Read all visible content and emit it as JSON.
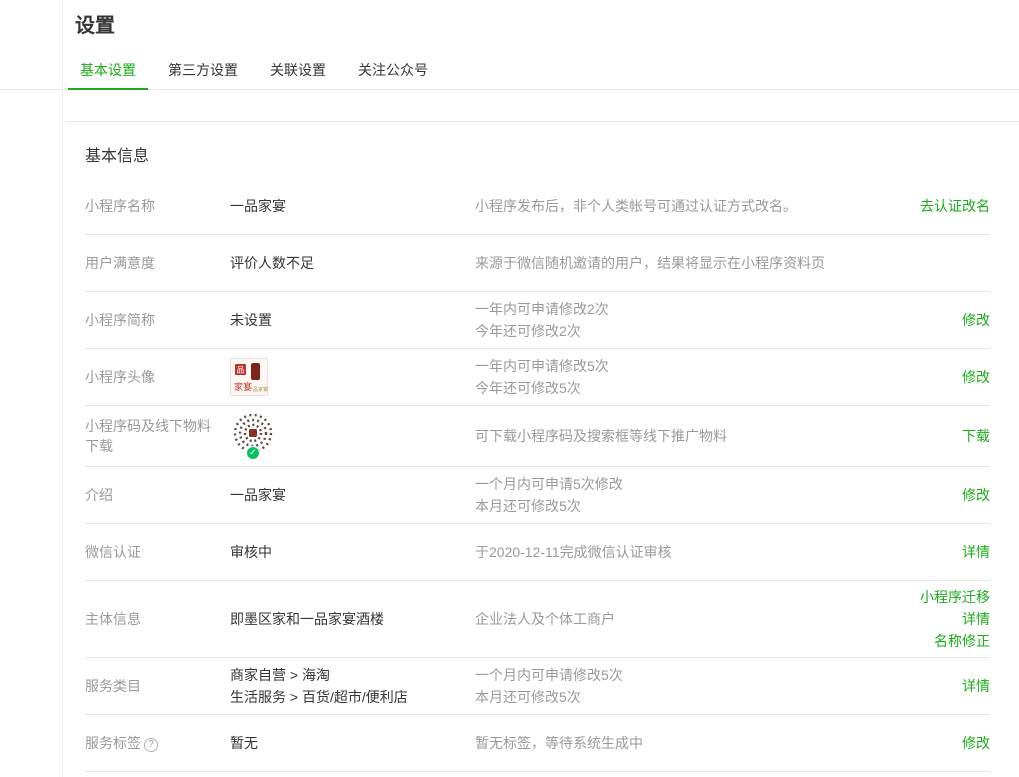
{
  "page": {
    "title": "设置"
  },
  "tabs": {
    "items": [
      {
        "label": "基本设置",
        "active": true
      },
      {
        "label": "第三方设置",
        "active": false
      },
      {
        "label": "关联设置",
        "active": false
      },
      {
        "label": "关注公众号",
        "active": false
      }
    ]
  },
  "section": {
    "heading": "基本信息"
  },
  "icons": {
    "help": "?",
    "verified_check": "✓"
  },
  "avatar": {
    "glyph": "品",
    "caption": "家宴",
    "brand": "一品家宴"
  },
  "rows": [
    {
      "label": "小程序名称",
      "value": "一品家宴",
      "desc1": "小程序发布后，非个人类帐号可通过认证方式改名。",
      "action1": "去认证改名"
    },
    {
      "label": "用户满意度",
      "value": "评价人数不足",
      "desc1": "来源于微信随机邀请的用户，结果将显示在小程序资料页"
    },
    {
      "label": "小程序简称",
      "value": "未设置",
      "desc1": "一年内可申请修改2次",
      "desc2": "今年还可修改2次",
      "action1": "修改"
    },
    {
      "label": "小程序头像",
      "desc1": "一年内可申请修改5次",
      "desc2": "今年还可修改5次",
      "action1": "修改"
    },
    {
      "label": "小程序码及线下物料下载",
      "desc1": "可下载小程序码及搜索框等线下推广物料",
      "action1": "下载"
    },
    {
      "label": "介绍",
      "value": "一品家宴",
      "desc1": "一个月内可申请5次修改",
      "desc2": "本月还可修改5次",
      "action1": "修改"
    },
    {
      "label": "微信认证",
      "value": "审核中",
      "desc1": "于2020-12-11完成微信认证审核",
      "action1": "详情"
    },
    {
      "label": "主体信息",
      "value": "即墨区家和一品家宴酒楼",
      "desc1": "企业法人及个体工商户",
      "action1": "小程序迁移",
      "action2": "详情",
      "action3": "名称修正"
    },
    {
      "label": "服务类目",
      "value": "商家自营 > 海淘",
      "value2": "生活服务 > 百货/超市/便利店",
      "desc1": "一个月内可申请修改5次",
      "desc2": "本月还可修改5次",
      "action1": "详情"
    },
    {
      "label": "服务标签",
      "value": "暂无",
      "desc1": "暂无标签，等待系统生成中",
      "action1": "修改"
    }
  ],
  "colors": {
    "accent_green": "#1aad19",
    "badge_green": "#07c160",
    "label_gray": "#9a9a9a",
    "text_dark": "#353535",
    "border_gray": "#e7e7eb"
  }
}
